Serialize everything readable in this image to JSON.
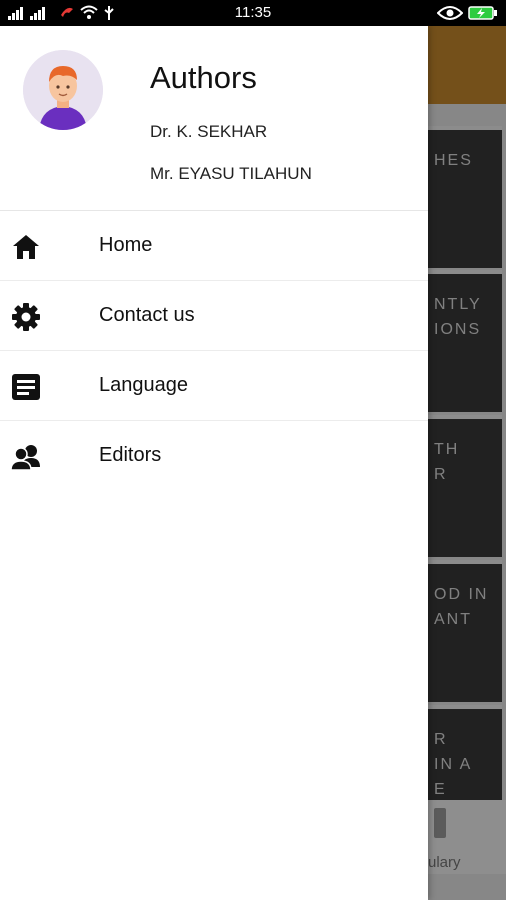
{
  "status_bar": {
    "time": "11:35",
    "signal_icon": "signal-bars-icon",
    "wifi_icon": "wifi-icon",
    "usb_icon": "usb-icon",
    "eye_icon": "eye-icon",
    "battery_icon": "battery-icon"
  },
  "drawer": {
    "header": {
      "title": "Authors",
      "authors": [
        "Dr. K. SEKHAR",
        "Mr. EYASU TILAHUN"
      ],
      "avatar_icon": "person-avatar-icon"
    },
    "menu": [
      {
        "label": "Home",
        "icon": "home-icon"
      },
      {
        "label": "Contact us",
        "icon": "gear-icon"
      },
      {
        "label": "Language",
        "icon": "document-icon"
      },
      {
        "label": "Editors",
        "icon": "people-icon"
      }
    ]
  },
  "background": {
    "cards": [
      {
        "lines": [
          "HES",
          ""
        ]
      },
      {
        "lines": [
          "NTLY",
          "IONS"
        ]
      },
      {
        "lines": [
          "TH",
          "R"
        ]
      },
      {
        "lines": [
          "OD IN",
          "ANT"
        ]
      },
      {
        "lines": [
          "R",
          "IN A",
          "E"
        ]
      }
    ],
    "bottom_label": "ulary"
  },
  "colors": {
    "accent": "#c98a2e",
    "status_bar": "#000000",
    "battery": "#2ecc40"
  }
}
